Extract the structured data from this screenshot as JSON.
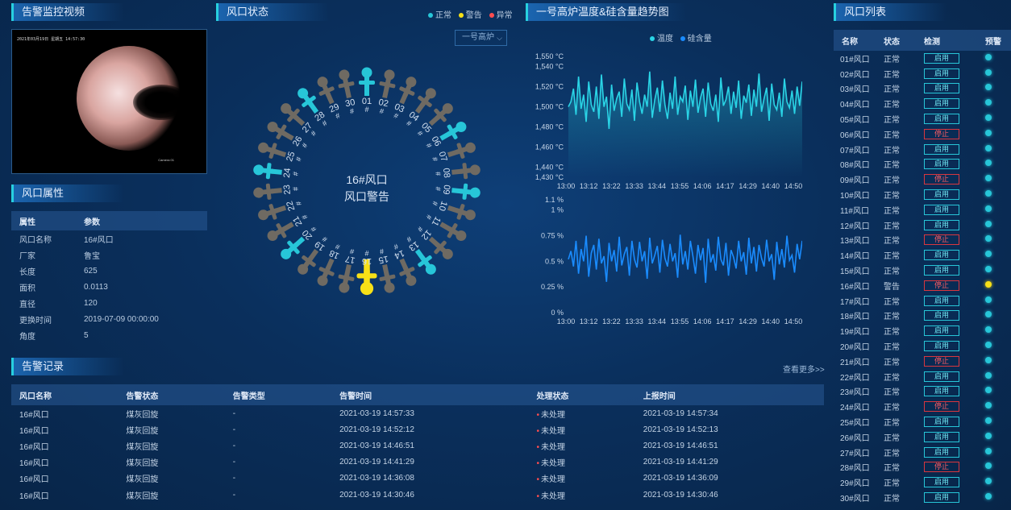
{
  "colors": {
    "normal": "#27c6d8",
    "warning": "#f7e017",
    "abnormal": "#ff4d4f",
    "idle": "#6f6a62"
  },
  "video": {
    "title": "告警监控视频",
    "timestamp": "2021年03月19日 星期五 14:57:30",
    "camera_label": "Camera 01"
  },
  "props": {
    "title": "风口属性",
    "header": {
      "attr": "属性",
      "val": "参数"
    },
    "rows": [
      {
        "k": "风口名称",
        "v": "16#风口"
      },
      {
        "k": "厂家",
        "v": "鲁宝"
      },
      {
        "k": "长度",
        "v": "625"
      },
      {
        "k": "面积",
        "v": "0.0113"
      },
      {
        "k": "直径",
        "v": "120"
      },
      {
        "k": "更换时间",
        "v": "2019-07-09 00:00:00"
      },
      {
        "k": "角度",
        "v": "5"
      }
    ]
  },
  "status": {
    "title": "风口状态",
    "legend": [
      "正常",
      "警告",
      "异常"
    ],
    "furnace_select": "一号高炉",
    "center_line1": "16#风口",
    "center_line2": "风口警告",
    "ports": [
      {
        "label": "01#",
        "state": "normal"
      },
      {
        "label": "02#",
        "state": "idle"
      },
      {
        "label": "03#",
        "state": "idle"
      },
      {
        "label": "04#",
        "state": "idle"
      },
      {
        "label": "05#",
        "state": "idle"
      },
      {
        "label": "06#",
        "state": "normal"
      },
      {
        "label": "07#",
        "state": "idle"
      },
      {
        "label": "08#",
        "state": "idle"
      },
      {
        "label": "09#",
        "state": "normal"
      },
      {
        "label": "10#",
        "state": "idle"
      },
      {
        "label": "11#",
        "state": "idle"
      },
      {
        "label": "12#",
        "state": "idle"
      },
      {
        "label": "13#",
        "state": "normal"
      },
      {
        "label": "14#",
        "state": "idle"
      },
      {
        "label": "15#",
        "state": "idle"
      },
      {
        "label": "16#",
        "state": "warning"
      },
      {
        "label": "17#",
        "state": "idle"
      },
      {
        "label": "18#",
        "state": "idle"
      },
      {
        "label": "19#",
        "state": "idle"
      },
      {
        "label": "20#",
        "state": "normal"
      },
      {
        "label": "21#",
        "state": "idle"
      },
      {
        "label": "22#",
        "state": "idle"
      },
      {
        "label": "23#",
        "state": "idle"
      },
      {
        "label": "24#",
        "state": "normal"
      },
      {
        "label": "25#",
        "state": "idle"
      },
      {
        "label": "26#",
        "state": "idle"
      },
      {
        "label": "27#",
        "state": "idle"
      },
      {
        "label": "28#",
        "state": "normal"
      },
      {
        "label": "29#",
        "state": "idle"
      },
      {
        "label": "30#",
        "state": "idle"
      }
    ]
  },
  "trend": {
    "title": "一号高炉温度&硅含量趋势图",
    "legend": [
      "温度",
      "硅含量"
    ]
  },
  "chart_data": [
    {
      "type": "line",
      "series": [
        {
          "name": "温度",
          "values": [
            1500,
            1505,
            1518,
            1492,
            1530,
            1498,
            1512,
            1485,
            1525,
            1502,
            1495,
            1520,
            1488,
            1532,
            1500,
            1510,
            1478,
            1522,
            1496,
            1508,
            1515,
            1490,
            1528,
            1503,
            1497,
            1517,
            1486,
            1524,
            1505,
            1493,
            1512,
            1500,
            1535,
            1489,
            1507,
            1519,
            1495,
            1526,
            1502,
            1488,
            1514,
            1498,
            1530,
            1492,
            1510,
            1505,
            1521,
            1487,
            1516,
            1500,
            1527,
            1494,
            1509,
            1518,
            1490,
            1524,
            1503,
            1496,
            1512,
            1485,
            1529,
            1501,
            1507,
            1520,
            1493,
            1515,
            1499,
            1526,
            1488,
            1511,
            1504,
            1522,
            1491,
            1517,
            1500,
            1533,
            1495,
            1508,
            1519,
            1486,
            1523,
            1502,
            1497,
            1514,
            1490,
            1528,
            1505,
            1499,
            1516,
            1493,
            1520,
            1501,
            1525
          ]
        }
      ],
      "x_ticks": [
        "13:00",
        "13:12",
        "13:22",
        "13:33",
        "13:44",
        "13:55",
        "14:06",
        "14:17",
        "14:29",
        "14:40",
        "14:50"
      ],
      "y_ticks": [
        "1,430 °C",
        "1,440 °C",
        "1,460 °C",
        "1,480 °C",
        "1,500 °C",
        "1,520 °C",
        "1,540 °C",
        "1,550 °C"
      ],
      "ylim": [
        1430,
        1550
      ]
    },
    {
      "type": "line",
      "series": [
        {
          "name": "硅含量",
          "values": [
            0.52,
            0.6,
            0.45,
            0.7,
            0.38,
            0.62,
            0.5,
            0.75,
            0.35,
            0.58,
            0.66,
            0.42,
            0.72,
            0.48,
            0.55,
            0.3,
            0.68,
            0.5,
            0.61,
            0.4,
            0.74,
            0.46,
            0.57,
            0.64,
            0.36,
            0.7,
            0.52,
            0.44,
            0.69,
            0.5,
            0.6,
            0.33,
            0.73,
            0.48,
            0.56,
            0.65,
            0.39,
            0.71,
            0.53,
            0.45,
            0.67,
            0.5,
            0.58,
            0.34,
            0.76,
            0.47,
            0.6,
            0.42,
            0.7,
            0.55,
            0.38,
            0.66,
            0.51,
            0.63,
            0.29,
            0.72,
            0.49,
            0.57,
            0.41,
            0.74,
            0.52,
            0.46,
            0.68,
            0.36,
            0.61,
            0.54,
            0.43,
            0.7,
            0.5,
            0.59,
            0.37,
            0.73,
            0.48,
            0.64,
            0.4,
            0.66,
            0.53,
            0.45,
            0.71,
            0.5,
            0.57,
            0.32,
            0.69,
            0.47,
            0.62,
            0.44,
            0.75,
            0.51,
            0.56,
            0.39,
            0.67,
            0.52,
            0.7
          ]
        }
      ],
      "x_ticks": [
        "13:00",
        "13:12",
        "13:22",
        "13:33",
        "13:44",
        "13:55",
        "14:06",
        "14:17",
        "14:29",
        "14:40",
        "14:50"
      ],
      "y_ticks": [
        "0 %",
        "0.25 %",
        "0.5 %",
        "0.75 %",
        "1 %",
        "1.1 %"
      ],
      "ylim": [
        0,
        1.1
      ]
    }
  ],
  "records": {
    "title": "告警记录",
    "more": "查看更多>>",
    "headers": [
      "风口名称",
      "告警状态",
      "告警类型",
      "告警时间",
      "处理状态",
      "上报时间"
    ],
    "rows": [
      [
        "16#风口",
        "煤灰回旋",
        "-",
        "2021-03-19 14:57:33",
        "未处理",
        "2021-03-19 14:57:34"
      ],
      [
        "16#风口",
        "煤灰回旋",
        "-",
        "2021-03-19 14:52:12",
        "未处理",
        "2021-03-19 14:52:13"
      ],
      [
        "16#风口",
        "煤灰回旋",
        "-",
        "2021-03-19 14:46:51",
        "未处理",
        "2021-03-19 14:46:51"
      ],
      [
        "16#风口",
        "煤灰回旋",
        "-",
        "2021-03-19 14:41:29",
        "未处理",
        "2021-03-19 14:41:29"
      ],
      [
        "16#风口",
        "煤灰回旋",
        "-",
        "2021-03-19 14:36:08",
        "未处理",
        "2021-03-19 14:36:09"
      ],
      [
        "16#风口",
        "煤灰回旋",
        "-",
        "2021-03-19 14:30:46",
        "未处理",
        "2021-03-19 14:30:46"
      ]
    ]
  },
  "ports": {
    "title": "风口列表",
    "headers": [
      "名称",
      "状态",
      "检测",
      "预警"
    ],
    "rows": [
      {
        "name": "01#风口",
        "status": "正常",
        "btn": "启用",
        "warn": false
      },
      {
        "name": "02#风口",
        "status": "正常",
        "btn": "启用",
        "warn": false
      },
      {
        "name": "03#风口",
        "status": "正常",
        "btn": "启用",
        "warn": false
      },
      {
        "name": "04#风口",
        "status": "正常",
        "btn": "启用",
        "warn": false
      },
      {
        "name": "05#风口",
        "status": "正常",
        "btn": "启用",
        "warn": false
      },
      {
        "name": "06#风口",
        "status": "正常",
        "btn": "停止",
        "warn": false
      },
      {
        "name": "07#风口",
        "status": "正常",
        "btn": "启用",
        "warn": false
      },
      {
        "name": "08#风口",
        "status": "正常",
        "btn": "启用",
        "warn": false
      },
      {
        "name": "09#风口",
        "status": "正常",
        "btn": "停止",
        "warn": false
      },
      {
        "name": "10#风口",
        "status": "正常",
        "btn": "启用",
        "warn": false
      },
      {
        "name": "11#风口",
        "status": "正常",
        "btn": "启用",
        "warn": false
      },
      {
        "name": "12#风口",
        "status": "正常",
        "btn": "启用",
        "warn": false
      },
      {
        "name": "13#风口",
        "status": "正常",
        "btn": "停止",
        "warn": false
      },
      {
        "name": "14#风口",
        "status": "正常",
        "btn": "启用",
        "warn": false
      },
      {
        "name": "15#风口",
        "status": "正常",
        "btn": "启用",
        "warn": false
      },
      {
        "name": "16#风口",
        "status": "警告",
        "btn": "停止",
        "warn": true
      },
      {
        "name": "17#风口",
        "status": "正常",
        "btn": "启用",
        "warn": false
      },
      {
        "name": "18#风口",
        "status": "正常",
        "btn": "启用",
        "warn": false
      },
      {
        "name": "19#风口",
        "status": "正常",
        "btn": "启用",
        "warn": false
      },
      {
        "name": "20#风口",
        "status": "正常",
        "btn": "启用",
        "warn": false
      },
      {
        "name": "21#风口",
        "status": "正常",
        "btn": "停止",
        "warn": false
      },
      {
        "name": "22#风口",
        "status": "正常",
        "btn": "启用",
        "warn": false
      },
      {
        "name": "23#风口",
        "status": "正常",
        "btn": "启用",
        "warn": false
      },
      {
        "name": "24#风口",
        "status": "正常",
        "btn": "停止",
        "warn": false
      },
      {
        "name": "25#风口",
        "status": "正常",
        "btn": "启用",
        "warn": false
      },
      {
        "name": "26#风口",
        "status": "正常",
        "btn": "启用",
        "warn": false
      },
      {
        "name": "27#风口",
        "status": "正常",
        "btn": "启用",
        "warn": false
      },
      {
        "name": "28#风口",
        "status": "正常",
        "btn": "停止",
        "warn": false
      },
      {
        "name": "29#风口",
        "status": "正常",
        "btn": "启用",
        "warn": false
      },
      {
        "name": "30#风口",
        "status": "正常",
        "btn": "启用",
        "warn": false
      }
    ]
  }
}
